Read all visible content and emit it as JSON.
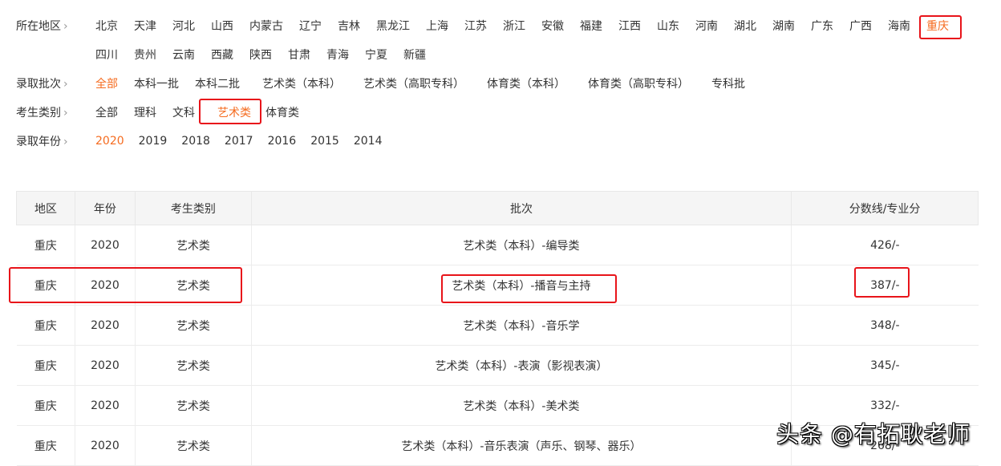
{
  "filters": {
    "region": {
      "label": "所在地区",
      "items": [
        "北京",
        "天津",
        "河北",
        "山西",
        "内蒙古",
        "辽宁",
        "吉林",
        "黑龙江",
        "上海",
        "江苏",
        "浙江",
        "安徽",
        "福建",
        "江西",
        "山东",
        "河南",
        "湖北",
        "湖南",
        "广东",
        "广西",
        "海南",
        "重庆"
      ],
      "items2": [
        "四川",
        "贵州",
        "云南",
        "西藏",
        "陕西",
        "甘肃",
        "青海",
        "宁夏",
        "新疆"
      ],
      "selected": "重庆"
    },
    "batch": {
      "label": "录取批次",
      "items": [
        "全部",
        "本科一批",
        "本科二批",
        "艺术类（本科）",
        "艺术类（高职专科）",
        "体育类（本科）",
        "体育类（高职专科）",
        "专科批"
      ],
      "selected": "全部"
    },
    "category": {
      "label": "考生类别",
      "items": [
        "全部",
        "理科",
        "文科",
        "艺术类",
        "体育类"
      ],
      "selected": "艺术类"
    },
    "year": {
      "label": "录取年份",
      "items": [
        "2020",
        "2019",
        "2018",
        "2017",
        "2016",
        "2015",
        "2014"
      ],
      "selected": "2020"
    }
  },
  "table": {
    "headers": [
      "地区",
      "年份",
      "考生类别",
      "批次",
      "分数线/专业分"
    ],
    "rows": [
      [
        "重庆",
        "2020",
        "艺术类",
        "艺术类（本科）-编导类",
        "426/-"
      ],
      [
        "重庆",
        "2020",
        "艺术类",
        "艺术类（本科）-播音与主持",
        "387/-"
      ],
      [
        "重庆",
        "2020",
        "艺术类",
        "艺术类（本科）-音乐学",
        "348/-"
      ],
      [
        "重庆",
        "2020",
        "艺术类",
        "艺术类（本科）-表演（影视表演）",
        "345/-"
      ],
      [
        "重庆",
        "2020",
        "艺术类",
        "艺术类（本科）-美术类",
        "332/-"
      ],
      [
        "重庆",
        "2020",
        "艺术类",
        "艺术类（本科）-音乐表演（声乐、钢琴、器乐）",
        "268/-"
      ]
    ]
  },
  "watermark": "头条 @有拓耿老师",
  "colors": {
    "active": "#f56b1f",
    "highlight": "#e8141a"
  }
}
